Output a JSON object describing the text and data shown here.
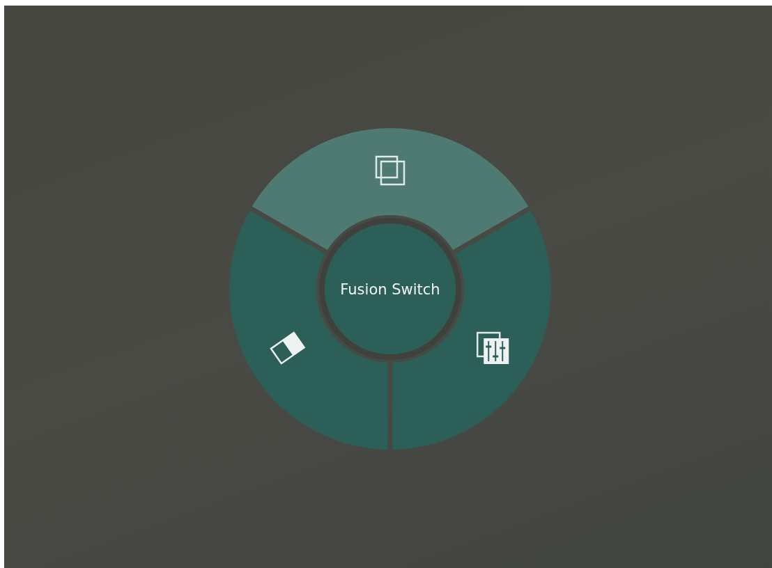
{
  "menu": {
    "title": "Fusion Switch",
    "segments": [
      {
        "kind": "layers",
        "selected": true
      },
      {
        "kind": "sliders",
        "selected": false
      },
      {
        "kind": "eraser",
        "selected": false
      }
    ]
  }
}
